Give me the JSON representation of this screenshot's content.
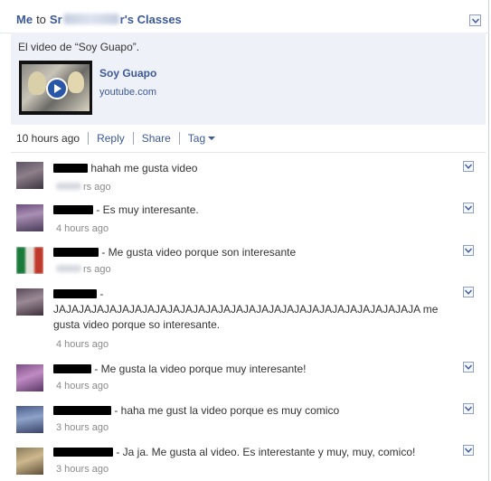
{
  "header": {
    "from": "Me",
    "to_word": "to",
    "group_prefix": "Sr",
    "group_suffix": "r's Classes"
  },
  "post": {
    "message": "El video de “Soy Guapo”.",
    "video_title": "Soy Guapo",
    "video_source": "youtube.com"
  },
  "actions": {
    "time": "10 hours ago",
    "reply": "Reply",
    "share": "Share",
    "tag": "Tag"
  },
  "comments": [
    {
      "text": " hahah me gusta video",
      "time_suffix": "rs ago"
    },
    {
      "text": " - Es muy interesante.",
      "time": "4 hours ago"
    },
    {
      "text": " - Me gusta video porque son interesante",
      "time_suffix": "rs ago"
    },
    {
      "text_line1": " -",
      "text_line2": "JAJAJAJAJAJAJAJAJAJAJAJAJAJAJAJAJAJAJAJAJAJAJAJAJAJAJAJAJA me gusta video porque so interesante.",
      "time": "4 hours ago"
    },
    {
      "text": " - Me gusta la video porque muy interesante!",
      "time": "4 hours ago"
    },
    {
      "text": " - haha me gust la video porque es muy comico",
      "time": "3 hours ago"
    },
    {
      "text": " - Ja ja. Me gusta al video. Es interestante y muy, muy, comico!",
      "time": "3 hours ago"
    }
  ],
  "colors": {
    "link": "#3b5998",
    "post_bg": "#eef1f8",
    "timestamp": "#8a8a8a"
  },
  "icons": {
    "menu_chevron": "chevron-down-icon",
    "play": "play-icon"
  }
}
